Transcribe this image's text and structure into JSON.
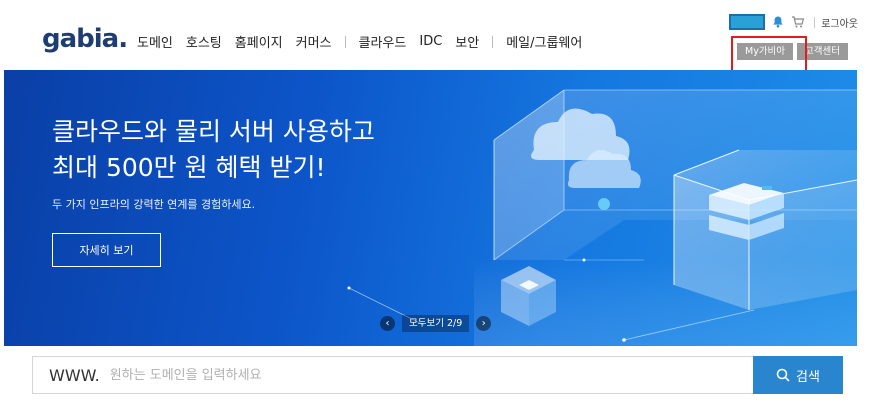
{
  "header": {
    "logo_text": "gabia",
    "logo_dot": ".",
    "nav": [
      {
        "label": "도메인"
      },
      {
        "label": "호스팅"
      },
      {
        "label": "홈페이지"
      },
      {
        "label": "커머스"
      },
      {
        "label": "클라우드"
      },
      {
        "label": "IDC"
      },
      {
        "label": "보안"
      },
      {
        "label": "메일/그룹웨어"
      }
    ],
    "logout_label": "로그아웃",
    "my_gabia_label": "My가비아",
    "support_label": "고객센터"
  },
  "banner": {
    "headline_line1": "클라우드와 물리 서버 사용하고",
    "headline_line2": "최대 500만 원 혜택 받기!",
    "description": "두 가지 인프라의 강력한 연계를 경험하세요.",
    "detail_button": "자세히 보기",
    "pager_label": "모두보기  2/9"
  },
  "search": {
    "prefix": "WWW.",
    "placeholder": "원하는 도메인을 입력하세요",
    "value": "",
    "button_label": "검색"
  },
  "colors": {
    "brand": "#1e3d73",
    "banner_dark": "#0a3fa6",
    "banner_light": "#1d8ee8",
    "search_button": "#2a85cf",
    "highlight": "#e31d1d"
  },
  "icons": [
    "notification-icon",
    "cart-icon",
    "search-icon",
    "chevron-left-icon",
    "chevron-right-icon"
  ]
}
